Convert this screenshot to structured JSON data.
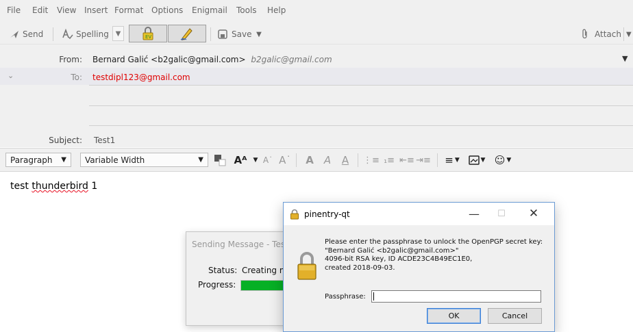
{
  "menubar": {
    "items": [
      "File",
      "Edit",
      "View",
      "Insert",
      "Format",
      "Options",
      "Enigmail",
      "Tools",
      "Help"
    ]
  },
  "toolbar": {
    "send": "Send",
    "spelling": "Spelling",
    "save": "Save",
    "attach": "Attach"
  },
  "headers": {
    "from_label": "From:",
    "from_value": "Bernard Galić <b2galic@gmail.com>",
    "from_identity": "b2galic@gmail.com",
    "to_label": "To:",
    "to_value": "testdipl123@gmail.com",
    "subject_label": "Subject:",
    "subject_value": "Test1"
  },
  "formatbar": {
    "paragraph": "Paragraph",
    "font": "Variable Width"
  },
  "body": {
    "text_pre": "test ",
    "text_misspelled": "thunderbird",
    "text_post": " 1"
  },
  "sending": {
    "title": "Sending Message - Tes",
    "status_label": "Status:",
    "status_value": "Creating m",
    "progress_label": "Progress:",
    "progress": 0.55
  },
  "pinentry": {
    "title": "pinentry-qt",
    "message": "Please enter the passphrase to unlock the OpenPGP secret key:\n\"Bernard Galić <b2galic@gmail.com>\"\n4096-bit RSA key, ID ACDE23C4B49EC1E0,\ncreated 2018-09-03.",
    "passphrase_label": "Passphrase:",
    "passphrase_value": "",
    "ok": "OK",
    "cancel": "Cancel"
  },
  "colors": {
    "recipient": "#e00000",
    "progress_fill": "#06b025",
    "dialog_border": "#6a9ad4",
    "lock_gold": "#e2b02a"
  }
}
